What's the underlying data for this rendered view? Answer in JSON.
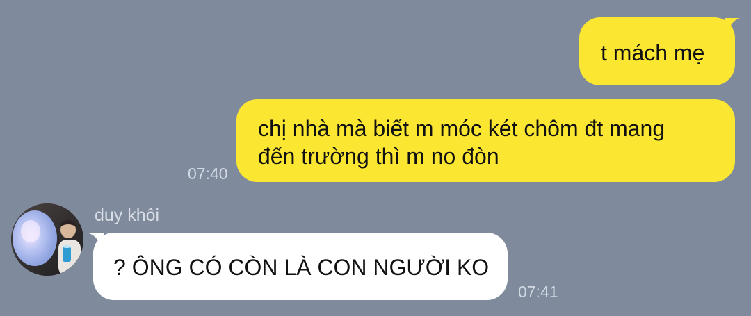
{
  "colors": {
    "background": "#7f8a9c",
    "outgoing_bubble": "#fbe632",
    "incoming_bubble": "#ffffff",
    "timestamp": "#d3d9e3"
  },
  "messages": [
    {
      "direction": "outgoing",
      "text": "t mách mẹ",
      "time": ""
    },
    {
      "direction": "outgoing",
      "line1": "chị nhà mà biết m móc két chôm đt mang",
      "line2": "đến trường thì m no đòn",
      "time": "07:40"
    },
    {
      "direction": "incoming",
      "sender": "duy khôi",
      "avatar_icon": "user-photo-avatar",
      "text": "? ÔNG CÓ CÒN LÀ CON NGƯỜI KO",
      "time": "07:41"
    }
  ]
}
